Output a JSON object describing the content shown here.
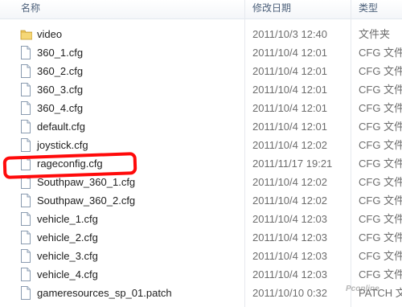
{
  "columns": {
    "name": "名称",
    "date": "修改日期",
    "type": "类型"
  },
  "files": [
    {
      "icon": "folder-icon",
      "name": "video",
      "date": "2011/10/3 12:40",
      "type": "文件夹"
    },
    {
      "icon": "file-icon",
      "name": "360_1.cfg",
      "date": "2011/10/4 12:01",
      "type": "CFG 文件"
    },
    {
      "icon": "file-icon",
      "name": "360_2.cfg",
      "date": "2011/10/4 12:01",
      "type": "CFG 文件"
    },
    {
      "icon": "file-icon",
      "name": "360_3.cfg",
      "date": "2011/10/4 12:01",
      "type": "CFG 文件"
    },
    {
      "icon": "file-icon",
      "name": "360_4.cfg",
      "date": "2011/10/4 12:01",
      "type": "CFG 文件"
    },
    {
      "icon": "file-icon",
      "name": "default.cfg",
      "date": "2011/10/4 12:01",
      "type": "CFG 文件"
    },
    {
      "icon": "file-icon",
      "name": "joystick.cfg",
      "date": "2011/10/4 12:02",
      "type": "CFG 文件"
    },
    {
      "icon": "file-icon",
      "name": "rageconfig.cfg",
      "date": "2011/11/17 19:21",
      "type": "CFG 文件"
    },
    {
      "icon": "file-icon",
      "name": "Southpaw_360_1.cfg",
      "date": "2011/10/4 12:02",
      "type": "CFG 文件"
    },
    {
      "icon": "file-icon",
      "name": "Southpaw_360_2.cfg",
      "date": "2011/10/4 12:02",
      "type": "CFG 文件"
    },
    {
      "icon": "file-icon",
      "name": "vehicle_1.cfg",
      "date": "2011/10/4 12:03",
      "type": "CFG 文件"
    },
    {
      "icon": "file-icon",
      "name": "vehicle_2.cfg",
      "date": "2011/10/4 12:03",
      "type": "CFG 文件"
    },
    {
      "icon": "file-icon",
      "name": "vehicle_3.cfg",
      "date": "2011/10/4 12:03",
      "type": "CFG 文件"
    },
    {
      "icon": "file-icon",
      "name": "vehicle_4.cfg",
      "date": "2011/10/4 12:03",
      "type": "CFG 文件"
    },
    {
      "icon": "file-icon",
      "name": "gameresources_sp_01.patch",
      "date": "2011/10/10 0:32",
      "type": "PATCH 文件"
    }
  ],
  "highlighted_file": "rageconfig.cfg",
  "annotation_color": "#ff0a0a",
  "watermark": "Pconline"
}
